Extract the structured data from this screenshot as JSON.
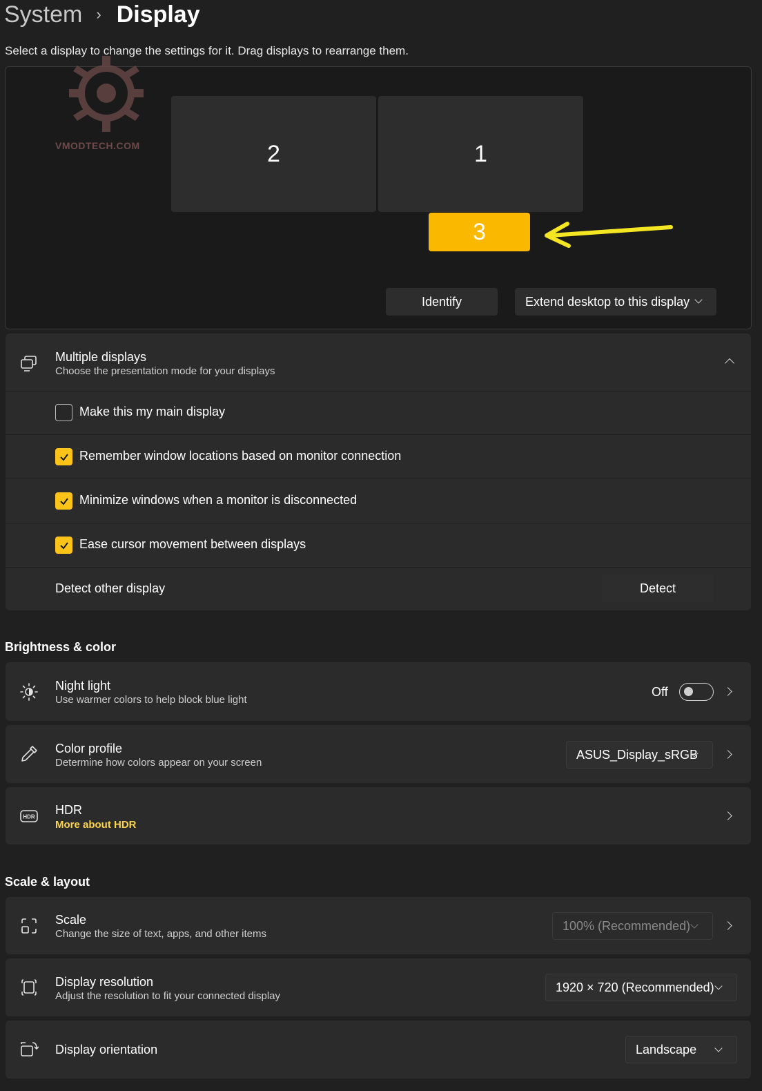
{
  "breadcrumb": {
    "parent": "System",
    "separator": "›",
    "current": "Display"
  },
  "subtitle": "Select a display to change the settings for it. Drag displays to rearrange them.",
  "arrangement": {
    "monitors": [
      {
        "label": "2",
        "selected": false
      },
      {
        "label": "1",
        "selected": false
      },
      {
        "label": "3",
        "selected": true
      }
    ],
    "watermark_text": "VMODTECH.COM",
    "identify_button": "Identify",
    "mode_dropdown": "Extend desktop to this display",
    "accent_color": "#fbb800",
    "annotation_arrow_color": "#f5e623"
  },
  "multiple_displays": {
    "title": "Multiple displays",
    "subtitle": "Choose the presentation mode for your displays",
    "options": [
      {
        "label": "Make this my main display",
        "checked": false
      },
      {
        "label": "Remember window locations based on monitor connection",
        "checked": true
      },
      {
        "label": "Minimize windows when a monitor is disconnected",
        "checked": true
      },
      {
        "label": "Ease cursor movement between displays",
        "checked": true
      }
    ],
    "detect_label": "Detect other display",
    "detect_button": "Detect"
  },
  "brightness_color": {
    "heading": "Brightness & color",
    "night_light": {
      "title": "Night light",
      "subtitle": "Use warmer colors to help block blue light",
      "state_label": "Off",
      "on": false
    },
    "color_profile": {
      "title": "Color profile",
      "subtitle": "Determine how colors appear on your screen",
      "value": "ASUS_Display_sRGB"
    },
    "hdr": {
      "title": "HDR",
      "link": "More about HDR"
    }
  },
  "scale_layout": {
    "heading": "Scale & layout",
    "scale": {
      "title": "Scale",
      "subtitle": "Change the size of text, apps, and other items",
      "value": "100% (Recommended)"
    },
    "resolution": {
      "title": "Display resolution",
      "subtitle": "Adjust the resolution to fit your connected display",
      "value": "1920 × 720 (Recommended)"
    },
    "orientation": {
      "title": "Display orientation",
      "value": "Landscape"
    }
  },
  "icons": [
    "chevron-right-icon",
    "chevron-down-icon",
    "chevron-up-icon",
    "multiple-displays-icon",
    "checkmark-icon",
    "brightness-icon",
    "eyedropper-icon",
    "hdr-icon",
    "scale-icon",
    "resolution-icon",
    "orientation-icon"
  ]
}
